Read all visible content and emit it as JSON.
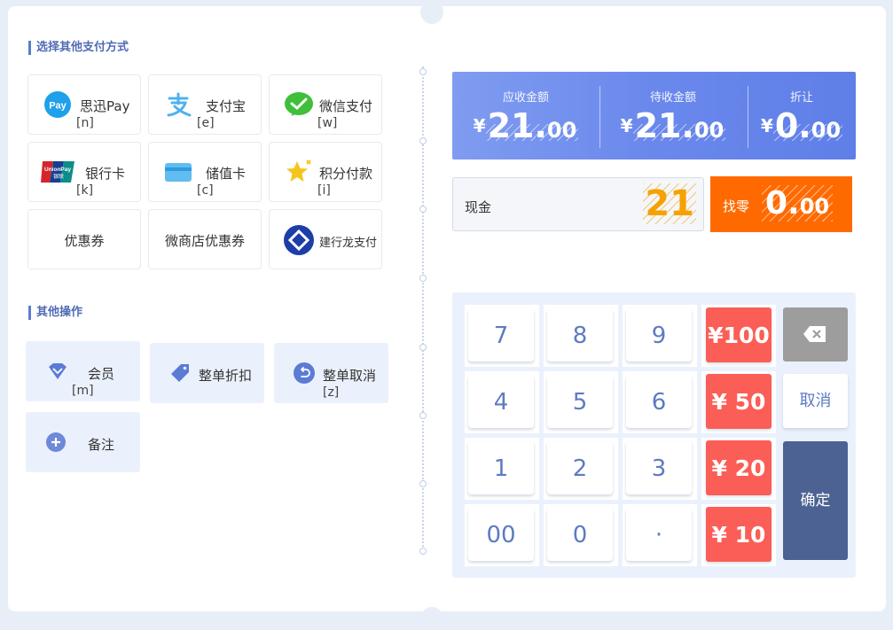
{
  "sections": {
    "pay_methods_title": "选择其他支付方式",
    "other_ops_title": "其他操作"
  },
  "pay_methods": [
    {
      "label": "思迅Pay",
      "key": "[n]",
      "icon": "xunpay-icon",
      "icon_text": "Pay"
    },
    {
      "label": "支付宝",
      "key": "[e]",
      "icon": "alipay-icon"
    },
    {
      "label": "微信支付",
      "key": "[w]",
      "icon": "wechat-pay-icon"
    },
    {
      "label": "银行卡",
      "key": "[k]",
      "icon": "unionpay-card-icon",
      "icon_text": "UnionPay",
      "icon_subtext": "银联"
    },
    {
      "label": "储值卡",
      "key": "[c]",
      "icon": "stored-value-card-icon"
    },
    {
      "label": "积分付款",
      "key": "[i]",
      "icon": "points-star-icon"
    },
    {
      "label": "优惠券"
    },
    {
      "label": "微商店优惠券"
    },
    {
      "label": "建行龙支付",
      "icon": "ccb-long-pay-icon"
    }
  ],
  "other_ops": [
    {
      "label": "会员",
      "key": "[m]",
      "icon": "member-diamond-icon"
    },
    {
      "label": "整单折扣",
      "icon": "discount-tag-icon"
    },
    {
      "label": "整单取消",
      "key": "[z]",
      "icon": "undo-circle-icon"
    },
    {
      "label": "备注",
      "icon": "plus-circle-icon"
    }
  ],
  "summary": {
    "currency": "¥",
    "receivable": {
      "label": "应收金额",
      "int": "21.",
      "dec": "00"
    },
    "pending": {
      "label": "待收金额",
      "int": "21.",
      "dec": "00"
    },
    "discount": {
      "label": "折让",
      "int": "0.",
      "dec": "00"
    }
  },
  "cash": {
    "label": "现金",
    "value": "21"
  },
  "change": {
    "label": "找零",
    "int": "0.",
    "dec": "00"
  },
  "keypad": {
    "keys": [
      "7",
      "8",
      "9",
      "4",
      "5",
      "6",
      "1",
      "2",
      "3",
      "00",
      "0",
      "·"
    ],
    "money": [
      "¥100",
      "¥ 50",
      "¥ 20",
      "¥ 10"
    ],
    "cancel": "取消",
    "confirm": "确定"
  },
  "colors": {
    "accent": "#5b7bd5",
    "summary_bg": "#6a88ec",
    "cash_value": "#f5a200",
    "change_bg": "#ff6a00",
    "money_key": "#fb5e56",
    "confirm_bg": "#4b6293",
    "delete_bg": "#9d9d9d"
  }
}
